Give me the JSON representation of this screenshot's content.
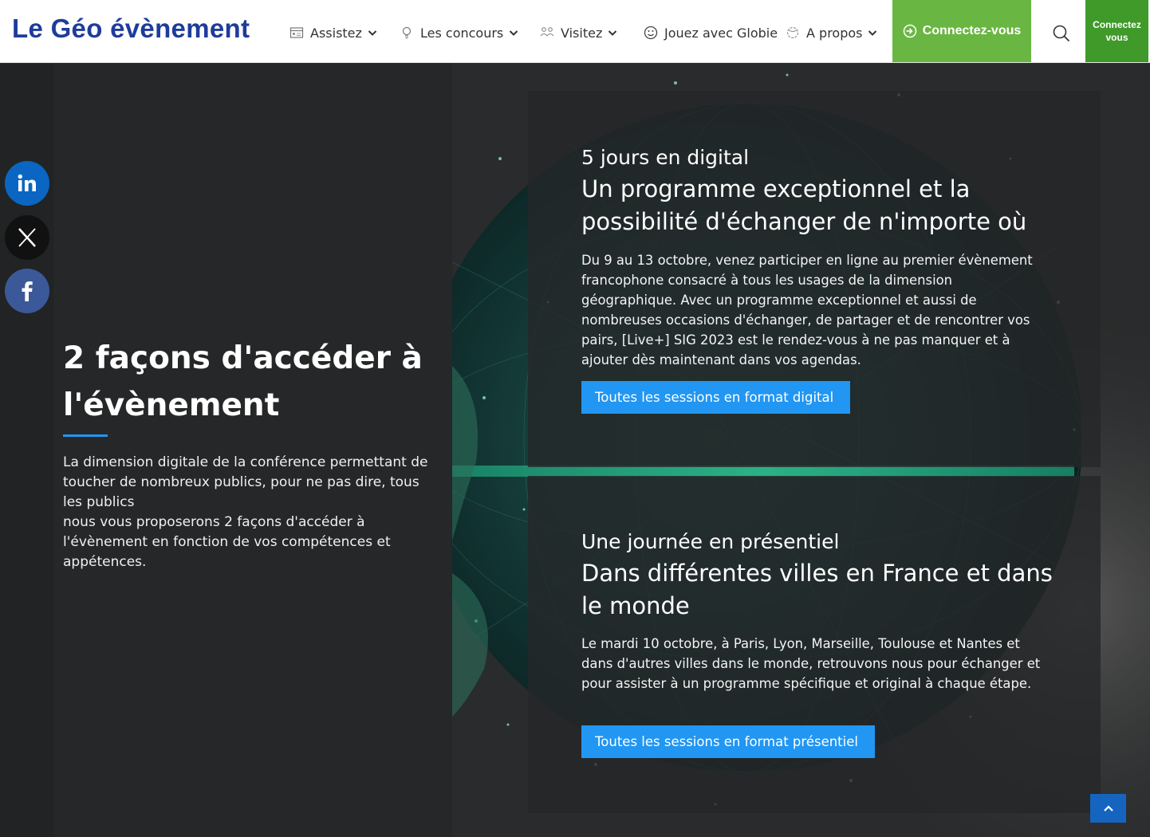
{
  "header": {
    "logo": "Le Géo évènement",
    "nav": [
      {
        "label": "Assistez",
        "icon": "calendar-icon",
        "dropdown": true
      },
      {
        "label": "Les concours",
        "icon": "lightbulb-icon",
        "dropdown": true
      },
      {
        "label": "Visitez",
        "icon": "people-icon",
        "dropdown": true
      },
      {
        "label": "Jouez avec Globie",
        "icon": "smiley-icon",
        "dropdown": false
      },
      {
        "label": "A propos",
        "icon": "globe-icon",
        "dropdown": true
      }
    ],
    "connect_label": "Connectez-vous",
    "connect_small_line1": "Connectez",
    "connect_small_line2": "vous",
    "colors": {
      "connect": "#6ab642",
      "connect_small": "#3f9a2a",
      "logo": "#1e3c9b"
    }
  },
  "social": [
    {
      "name": "linkedin",
      "label": "in",
      "color": "#0a66c2"
    },
    {
      "name": "x",
      "label": "X",
      "color": "#111111"
    },
    {
      "name": "facebook",
      "label": "f",
      "color": "#3b5998"
    }
  ],
  "intro": {
    "title": "2 façons d'accéder à l'évènement",
    "text_line1": "La dimension digitale de la conférence permettant de toucher de nombreux publics, pour ne pas dire, tous les publics",
    "text_line2": "nous vous proposerons 2 façons d'accéder à l'évènement en fonction de vos compétences et appétences."
  },
  "cards": [
    {
      "kicker": "5 jours en digital",
      "title": "Un programme exceptionnel et la possibilité d'échanger de n'importe où",
      "text": "Du 9 au 13 octobre, venez participer en ligne au premier évènement francophone consacré à tous les usages de la dimension géographique. Avec un programme exceptionnel et aussi de nombreuses occasions d'échanger, de partager et de rencontrer vos pairs, [Live+] SIG 2023 est le rendez-vous à ne pas manquer et à ajouter dès maintenant dans vos agendas.",
      "button": "Toutes les sessions en format digital"
    },
    {
      "kicker": "Une journée en présentiel",
      "title": "Dans différentes villes en France et dans le monde",
      "text": "Le mardi 10 octobre, à Paris, Lyon, Marseille, Toulouse et Nantes et dans d'autres villes dans le monde, retrouvons nous pour échanger et pour assister à un programme spécifique et original à chaque étape.",
      "button": "Toutes les sessions en format présentiel"
    }
  ],
  "accent": "#2196f3"
}
